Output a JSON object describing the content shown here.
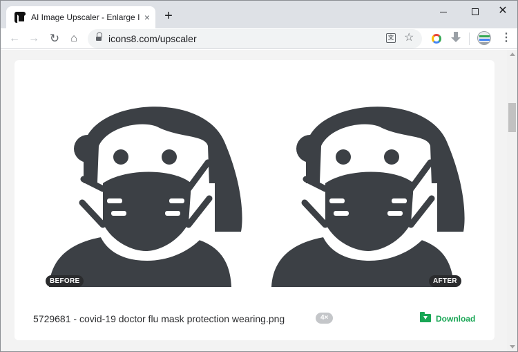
{
  "browser": {
    "tab_title": "AI Image Upscaler - Enlarge Im",
    "tab_close": "×",
    "new_tab": "+",
    "url": "icons8.com/upscaler",
    "window_close": "✕"
  },
  "toolbar": {
    "back": "←",
    "forward": "→",
    "reload": "↻",
    "home": "⌂",
    "star": "☆",
    "translate": "文",
    "menu": "⋮"
  },
  "result": {
    "before_label": "BEFORE",
    "after_label": "AFTER",
    "filename": "5729681 - covid-19 doctor flu mask protection wearing.png",
    "scale": "4×",
    "download_label": "Download",
    "icon_color": "#3c4045",
    "accent_color": "#19a655"
  }
}
